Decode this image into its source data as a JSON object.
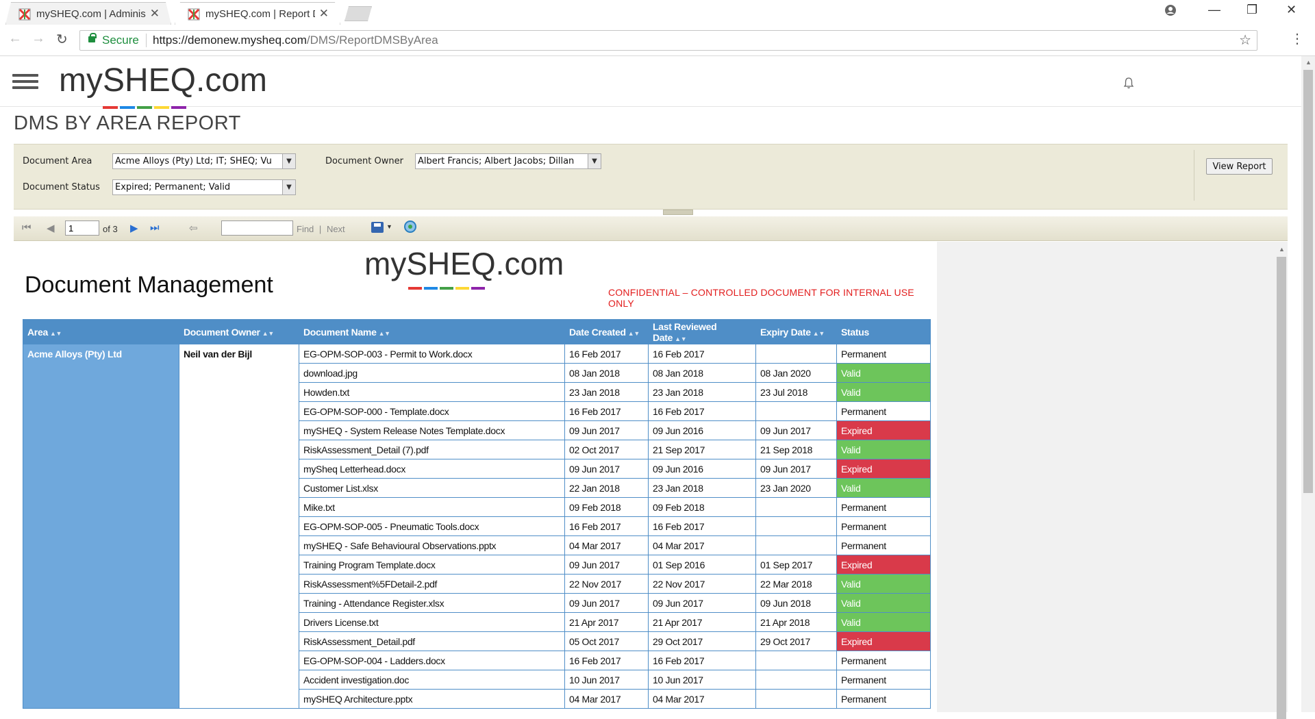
{
  "browser": {
    "tabs": [
      {
        "title": "mySHEQ.com | Administr",
        "active": false
      },
      {
        "title": "mySHEQ.com | Report DM",
        "active": true
      }
    ],
    "secure_label": "Secure",
    "url_host": "https://demonew.mysheq.com",
    "url_path": "/DMS/ReportDMSByArea"
  },
  "app": {
    "logo_text": "mySHEQ.com",
    "logo_colors": [
      "#e53935",
      "#1e88e5",
      "#43a047",
      "#fdd835",
      "#8e24aa"
    ]
  },
  "page": {
    "title": "DMS BY AREA REPORT"
  },
  "params": {
    "area_label": "Document Area",
    "area_value": "Acme Alloys (Pty) Ltd; IT; SHEQ; Vu",
    "owner_label": "Document Owner",
    "owner_value": "Albert Francis; Albert Jacobs; Dillan",
    "status_label": "Document Status",
    "status_value": "Expired; Permanent; Valid",
    "view_button": "View Report"
  },
  "viewer": {
    "current_page": "1",
    "of_pages": "of 3",
    "find_label": "Find",
    "separator": "|",
    "next_label": "Next"
  },
  "report": {
    "title": "Document Management",
    "logo_text": "mySHEQ.com",
    "confidential": "CONFIDENTIAL –  CONTROLLED DOCUMENT FOR INTERNAL USE ONLY",
    "columns": [
      "Area",
      "Document Owner",
      "Document Name",
      "Date Created",
      "Last Reviewed Date",
      "Expiry Date",
      "Status"
    ],
    "area": "Acme Alloys (Pty) Ltd",
    "owner": "Neil van der Bijl",
    "rows": [
      {
        "name": "EG-OPM-SOP-003 - Permit to Work.docx",
        "created": "16 Feb 2017",
        "reviewed": "16 Feb 2017",
        "expiry": "",
        "status": "Permanent"
      },
      {
        "name": "download.jpg",
        "created": "08 Jan 2018",
        "reviewed": "08 Jan 2018",
        "expiry": "08 Jan 2020",
        "status": "Valid"
      },
      {
        "name": "Howden.txt",
        "created": "23 Jan 2018",
        "reviewed": "23 Jan 2018",
        "expiry": "23 Jul 2018",
        "status": "Valid"
      },
      {
        "name": "EG-OPM-SOP-000 - Template.docx",
        "created": "16 Feb 2017",
        "reviewed": "16 Feb 2017",
        "expiry": "",
        "status": "Permanent"
      },
      {
        "name": "mySHEQ - System Release Notes Template.docx",
        "created": "09 Jun 2017",
        "reviewed": "09 Jun 2016",
        "expiry": "09 Jun 2017",
        "status": "Expired"
      },
      {
        "name": "RiskAssessment_Detail (7).pdf",
        "created": "02 Oct 2017",
        "reviewed": "21 Sep 2017",
        "expiry": "21 Sep 2018",
        "status": "Valid"
      },
      {
        "name": "mySheq Letterhead.docx",
        "created": "09 Jun 2017",
        "reviewed": "09 Jun 2016",
        "expiry": "09 Jun 2017",
        "status": "Expired"
      },
      {
        "name": "Customer List.xlsx",
        "created": "22 Jan 2018",
        "reviewed": "23 Jan 2018",
        "expiry": "23 Jan 2020",
        "status": "Valid"
      },
      {
        "name": "Mike.txt",
        "created": "09 Feb 2018",
        "reviewed": "09 Feb 2018",
        "expiry": "",
        "status": "Permanent"
      },
      {
        "name": "EG-OPM-SOP-005 - Pneumatic Tools.docx",
        "created": "16 Feb 2017",
        "reviewed": "16 Feb 2017",
        "expiry": "",
        "status": "Permanent"
      },
      {
        "name": "mySHEQ - Safe Behavioural Observations.pptx",
        "created": "04 Mar 2017",
        "reviewed": "04 Mar 2017",
        "expiry": "",
        "status": "Permanent"
      },
      {
        "name": "Training Program Template.docx",
        "created": "09 Jun 2017",
        "reviewed": "01 Sep 2016",
        "expiry": "01 Sep 2017",
        "status": "Expired"
      },
      {
        "name": "RiskAssessment%5FDetail-2.pdf",
        "created": "22 Nov 2017",
        "reviewed": "22 Nov 2017",
        "expiry": "22 Mar 2018",
        "status": "Valid"
      },
      {
        "name": "Training - Attendance Register.xlsx",
        "created": "09 Jun 2017",
        "reviewed": "09 Jun 2017",
        "expiry": "09 Jun 2018",
        "status": "Valid"
      },
      {
        "name": "Drivers License.txt",
        "created": "21 Apr 2017",
        "reviewed": "21 Apr 2017",
        "expiry": "21 Apr 2018",
        "status": "Valid"
      },
      {
        "name": "RiskAssessment_Detail.pdf",
        "created": "05 Oct 2017",
        "reviewed": "29 Oct 2017",
        "expiry": "29 Oct 2017",
        "status": "Expired"
      },
      {
        "name": "EG-OPM-SOP-004 - Ladders.docx",
        "created": "16 Feb 2017",
        "reviewed": "16 Feb 2017",
        "expiry": "",
        "status": "Permanent"
      },
      {
        "name": "Accident investigation.doc",
        "created": "10 Jun 2017",
        "reviewed": "10 Jun 2017",
        "expiry": "",
        "status": "Permanent"
      },
      {
        "name": "mySHEQ Architecture.pptx",
        "created": "04 Mar 2017",
        "reviewed": "04 Mar 2017",
        "expiry": "",
        "status": "Permanent"
      }
    ],
    "status_colors": {
      "Valid": "#6dc55b",
      "Expired": "#d93a4a",
      "Permanent": "#ffffff"
    },
    "header_color": "#4f8ec7"
  }
}
